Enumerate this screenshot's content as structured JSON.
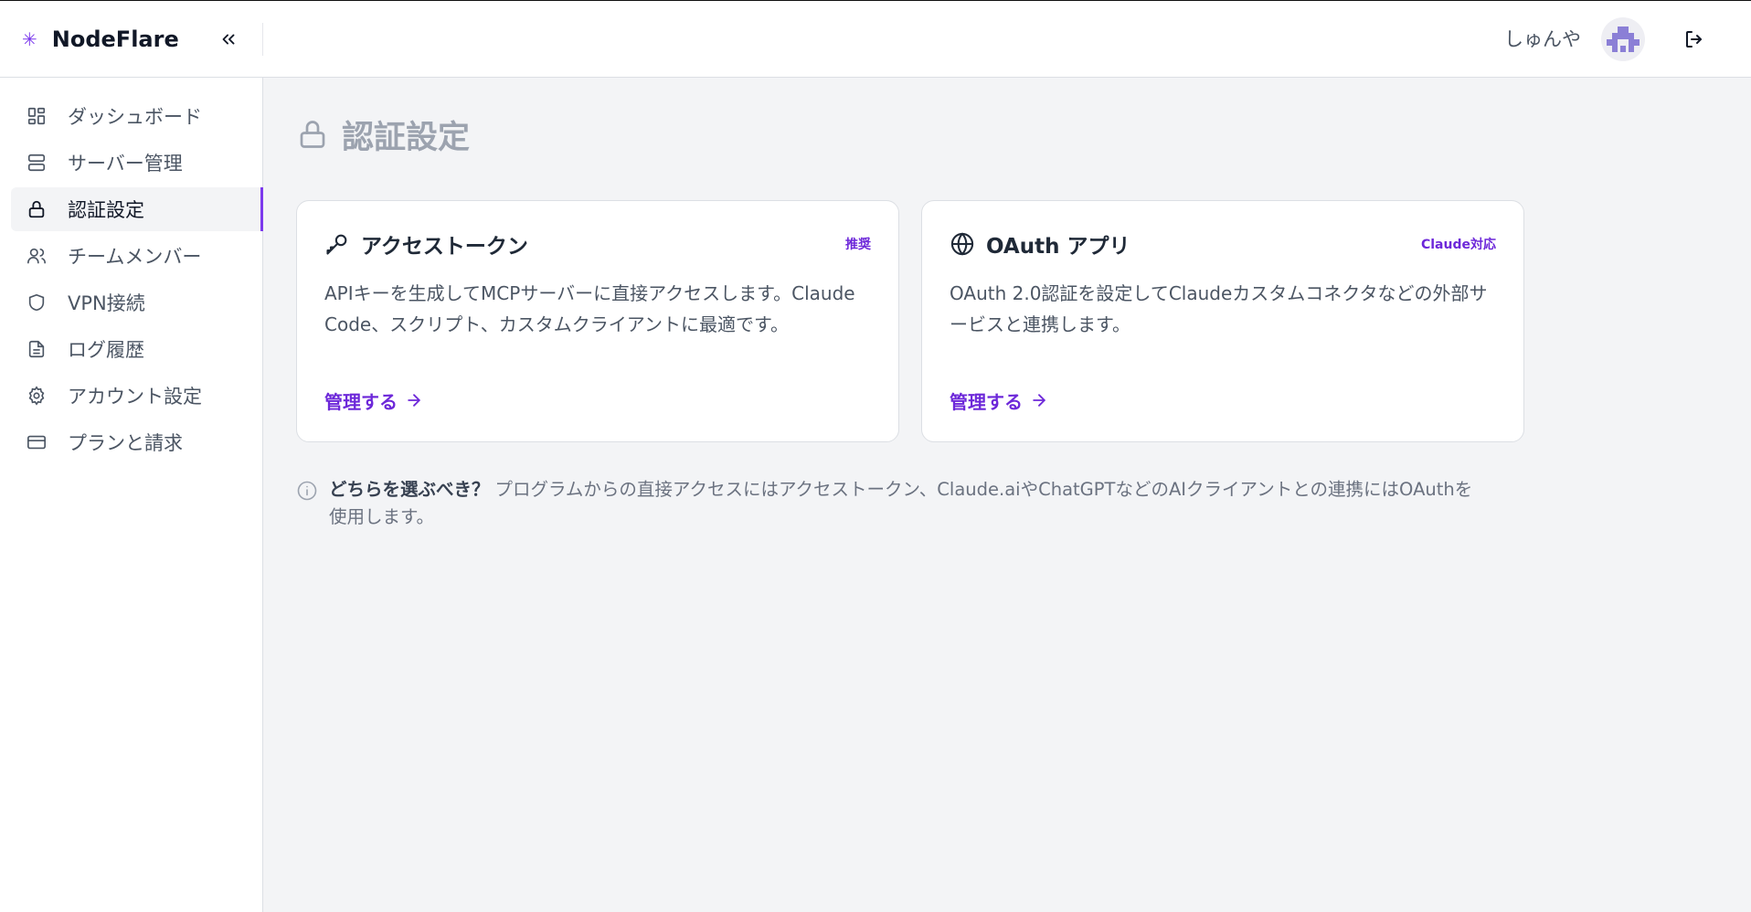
{
  "colors": {
    "accent": "#7c3aed",
    "accent_text": "#6d28d9",
    "background": "#f3f4f6"
  },
  "header": {
    "brand_icon": "asterisk-icon",
    "brand_name": "NodeFlare",
    "collapse_icon": "chevrons-left-icon",
    "user_name": "しゅんや",
    "avatar_icon": "pixel-avatar",
    "logout_icon": "logout-icon"
  },
  "sidebar": {
    "items": [
      {
        "label": "ダッシュボード",
        "icon": "dashboard-icon",
        "active": false
      },
      {
        "label": "サーバー管理",
        "icon": "server-icon",
        "active": false
      },
      {
        "label": "認証設定",
        "icon": "lock-icon",
        "active": true
      },
      {
        "label": "チームメンバー",
        "icon": "users-icon",
        "active": false
      },
      {
        "label": "VPN接続",
        "icon": "shield-icon",
        "active": false
      },
      {
        "label": "ログ履歴",
        "icon": "document-icon",
        "active": false
      },
      {
        "label": "アカウント設定",
        "icon": "gear-icon",
        "active": false
      },
      {
        "label": "プランと請求",
        "icon": "credit-card-icon",
        "active": false
      }
    ]
  },
  "page": {
    "title": "認証設定",
    "title_icon": "lock-icon"
  },
  "cards": [
    {
      "icon": "key-icon",
      "title": "アクセストークン",
      "badge": "推奨",
      "description": "APIキーを生成してMCPサーバーに直接アクセスします。Claude Code、スクリプト、カスタムクライアントに最適です。",
      "link": "管理する"
    },
    {
      "icon": "globe-icon",
      "title": "OAuth アプリ",
      "badge": "Claude対応",
      "description": "OAuth 2.0認証を設定してClaudeカスタムコネクタなどの外部サービスと連携します。",
      "link": "管理する"
    }
  ],
  "hint": {
    "icon": "info-icon",
    "title": "どちらを選ぶべき？",
    "text": "プログラムからの直接アクセスにはアクセストークン、Claude.aiやChatGPTなどのAIクライアントとの連携にはOAuthを使用します。"
  }
}
